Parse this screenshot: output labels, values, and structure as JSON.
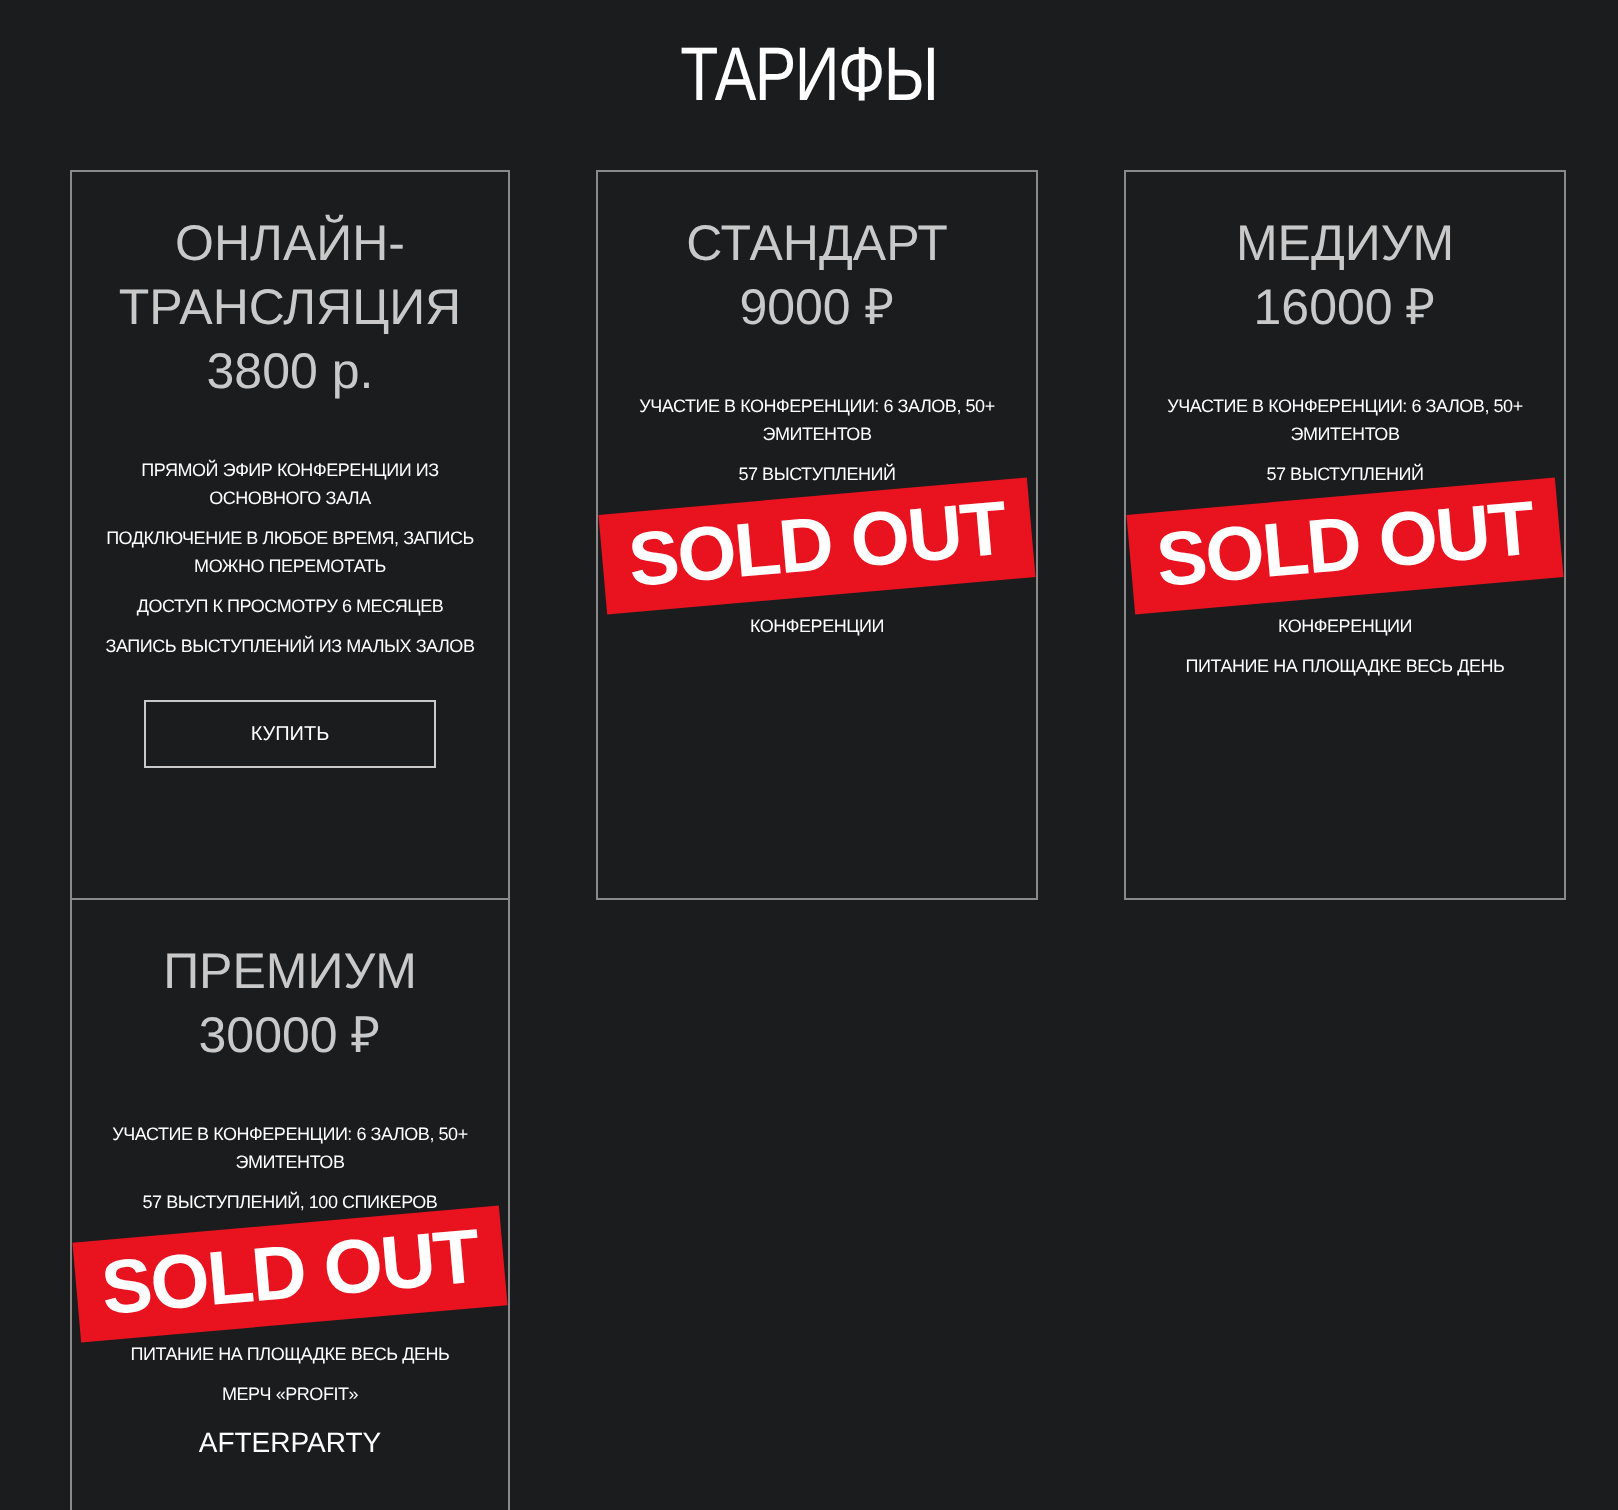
{
  "heading": "ТАРИФЫ",
  "plans": [
    {
      "title": "ОНЛАЙН-ТРАНСЛЯЦИЯ",
      "price": "3800 р.",
      "features": [
        {
          "text": "ПРЯМОЙ ЭФИР КОНФЕРЕНЦИИ ИЗ ОСНОВНОГО ЗАЛА",
          "kind": "small"
        },
        {
          "text": "ПОДКЛЮЧЕНИЕ В ЛЮБОЕ ВРЕМЯ, ЗАПИСЬ МОЖНО ПЕРЕМОТАТЬ",
          "kind": "small"
        },
        {
          "text": "ДОСТУП К ПРОСМОТРУ 6 МЕСЯЦЕВ",
          "kind": "small"
        },
        {
          "text": "ЗАПИСЬ ВЫСТУПЛЕНИЙ ИЗ МАЛЫХ ЗАЛОВ",
          "kind": "small"
        }
      ],
      "button": "КУПИТЬ"
    },
    {
      "title": "СТАНДАРТ",
      "price": "9000 ₽",
      "features": [
        {
          "text": "УЧАСТИЕ В КОНФЕРЕНЦИИ: 6 ЗАЛОВ, 50+ ЭМИТЕНТОВ",
          "kind": "small"
        },
        {
          "text": "57 ВЫСТУПЛЕНИЙ",
          "kind": "small"
        }
      ],
      "stamp": "SOLD OUT",
      "features_after": [
        {
          "text": "КОНФЕРЕНЦИИ",
          "kind": "small"
        }
      ]
    },
    {
      "title": "МЕДИУМ",
      "price": "16000 ₽",
      "features": [
        {
          "text": "УЧАСТИЕ В КОНФЕРЕНЦИИ: 6 ЗАЛОВ, 50+ ЭМИТЕНТОВ",
          "kind": "small"
        },
        {
          "text": "57 ВЫСТУПЛЕНИЙ",
          "kind": "small"
        }
      ],
      "stamp": "SOLD OUT",
      "features_after": [
        {
          "text": "КОНФЕРЕНЦИИ",
          "kind": "small"
        },
        {
          "text": "ПИТАНИЕ НА ПЛОЩАДКЕ ВЕСЬ ДЕНЬ",
          "kind": "small"
        }
      ]
    },
    {
      "title": "ПРЕМИУМ",
      "price": "30000 ₽",
      "features": [
        {
          "text": "УЧАСТИЕ В КОНФЕРЕНЦИИ: 6 ЗАЛОВ, 50+ ЭМИТЕНТОВ",
          "kind": "small"
        },
        {
          "text": "57 ВЫСТУПЛЕНИЙ, 100 СПИКЕРОВ",
          "kind": "small"
        }
      ],
      "stamp": "SOLD OUT",
      "features_after": [
        {
          "text": "ПИТАНИЕ НА ПЛОЩАДКЕ ВЕСЬ ДЕНЬ",
          "kind": "small"
        },
        {
          "text": "МЕРЧ «PROFIT»",
          "kind": "small"
        },
        {
          "text": "AFTERPARTY",
          "kind": "large"
        }
      ]
    }
  ]
}
